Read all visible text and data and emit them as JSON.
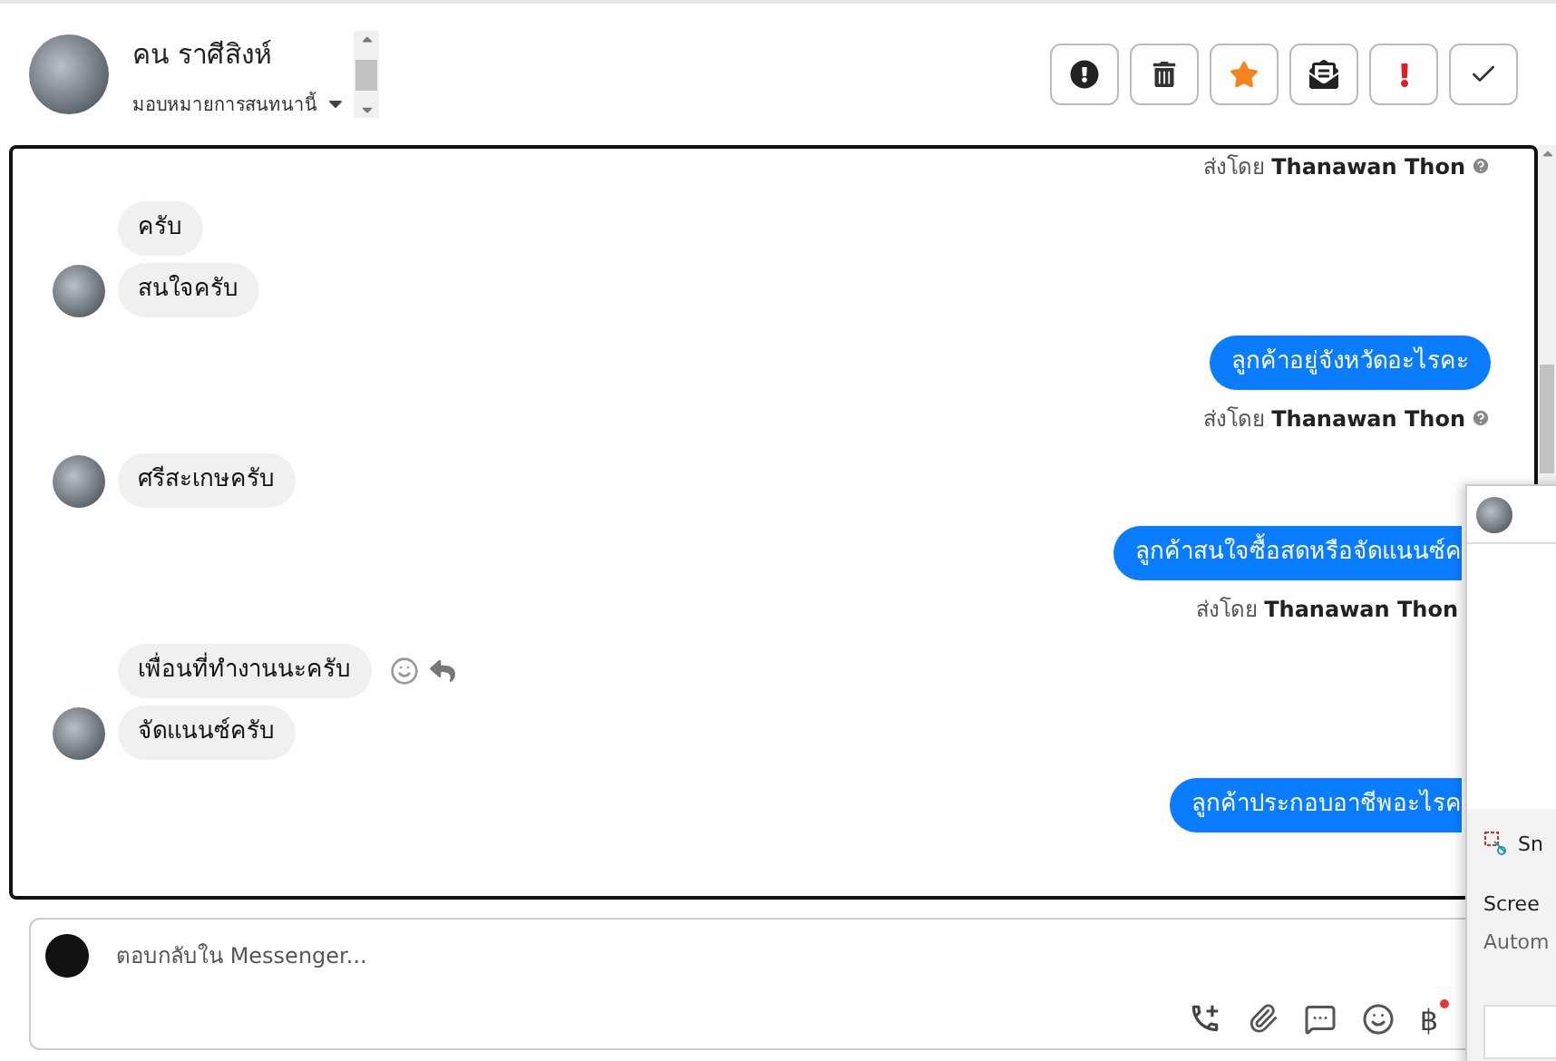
{
  "contact": {
    "name": "คน ราศีสิงห์",
    "assign_label": "มอบหมายการสนทนานี้"
  },
  "actions": [
    {
      "kind": "alert"
    },
    {
      "kind": "trash"
    },
    {
      "kind": "star"
    },
    {
      "kind": "mail"
    },
    {
      "kind": "urgent"
    },
    {
      "kind": "done"
    }
  ],
  "messages": [
    {
      "kind": "sent_by",
      "text": "ส่งโดย **Thanawan Thon**",
      "clipped": false
    },
    {
      "kind": "in",
      "text": "ครับ",
      "avatar": false
    },
    {
      "kind": "in",
      "text": "สนใจครับ",
      "avatar": true
    },
    {
      "kind": "out",
      "text": "ลูกค้าอยู่จังหวัดอะไรคะ",
      "clipped": false
    },
    {
      "kind": "sent_by",
      "text": "ส่งโดย **Thanawan Thon**",
      "clipped": false
    },
    {
      "kind": "in",
      "text": "ศรีสะเกษครับ",
      "avatar": true
    },
    {
      "kind": "out",
      "text": "ลูกค้าสนใจซื้อสดหรือจัดแนนซ์ค",
      "clipped": true
    },
    {
      "kind": "sent_by",
      "text": "ส่งโดย **Thanawan Thon**",
      "clipped": true
    },
    {
      "kind": "in",
      "text": "เพื่อนที่ทำงานนะครับ",
      "avatar": false,
      "hovered": true
    },
    {
      "kind": "in",
      "text": "จัดแนนซ์ครับ",
      "avatar": true
    },
    {
      "kind": "out",
      "text": "ลูกค้าประกอบอาชีพอะไรค",
      "clipped": true
    }
  ],
  "composer": {
    "placeholder": "ตอบกลับใน Messenger...",
    "currency": "฿"
  },
  "popup": {
    "app": "Sn",
    "title": "Scree",
    "subtitle": "Autom"
  }
}
